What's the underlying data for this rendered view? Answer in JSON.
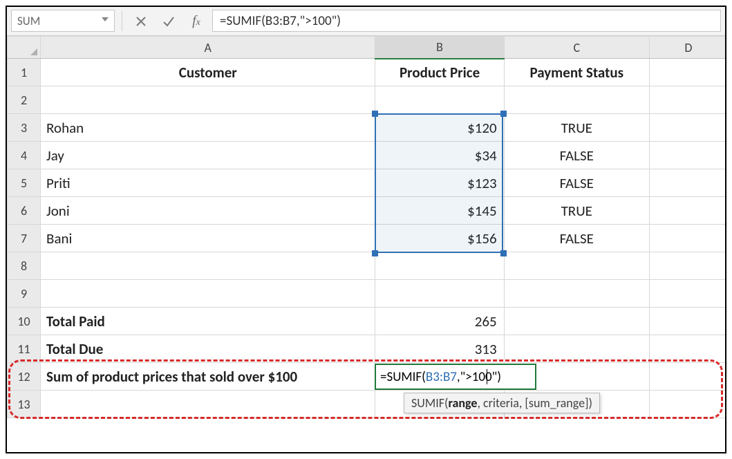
{
  "formula_bar": {
    "name_box": "SUM",
    "formula": "=SUMIF(B3:B7,\">100\")"
  },
  "columns": {
    "A": "A",
    "B": "B",
    "C": "C",
    "D": "D"
  },
  "headers": {
    "A": "Customer",
    "B": "Product Price",
    "C": "Payment Status"
  },
  "rows": [
    {
      "n": "1"
    },
    {
      "n": "2"
    },
    {
      "n": "3",
      "A": "Rohan",
      "B": "$120",
      "C": "TRUE"
    },
    {
      "n": "4",
      "A": "Jay",
      "B": "$34",
      "C": "FALSE"
    },
    {
      "n": "5",
      "A": "Priti",
      "B": "$123",
      "C": "FALSE"
    },
    {
      "n": "6",
      "A": "Joni",
      "B": "$145",
      "C": "TRUE"
    },
    {
      "n": "7",
      "A": "Bani",
      "B": "$156",
      "C": "FALSE"
    },
    {
      "n": "8"
    },
    {
      "n": "9"
    },
    {
      "n": "10",
      "A": "Total Paid",
      "B": "265"
    },
    {
      "n": "11",
      "A": "Total Due",
      "B": "313"
    },
    {
      "n": "12",
      "A": "Sum of product prices that sold over $100"
    },
    {
      "n": "13"
    }
  ],
  "editing": {
    "prefix": "=SUMIF(",
    "ref": "B3:B7",
    "suffix": ",\">100\")"
  },
  "tooltip": {
    "fn": "SUMIF",
    "args_bold": "range",
    "args_rest": ", criteria, [sum_range])"
  }
}
